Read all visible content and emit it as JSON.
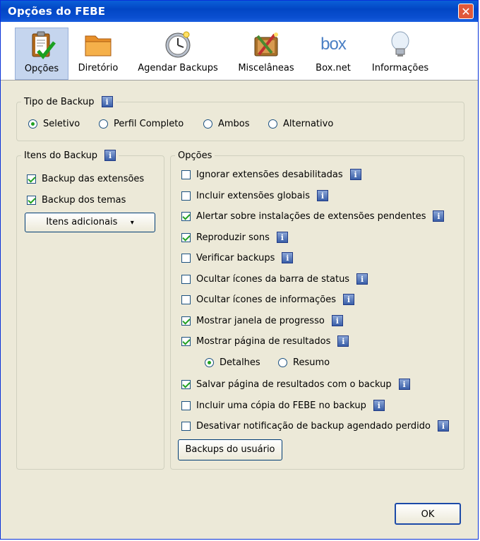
{
  "window": {
    "title": "Opções do FEBE",
    "close_glyph": "✕"
  },
  "toolbar": {
    "items": [
      {
        "label": "Opções",
        "icon": "clipboard-check-icon",
        "selected": true
      },
      {
        "label": "Diretório",
        "icon": "folder-icon"
      },
      {
        "label": "Agendar Backups",
        "icon": "clock-icon"
      },
      {
        "label": "Miscelâneas",
        "icon": "tools-icon"
      },
      {
        "label": "Box.net",
        "icon": "box-logo-icon",
        "logo_text": "box"
      },
      {
        "label": "Informações",
        "icon": "lightbulb-icon"
      }
    ]
  },
  "info_glyph": "i",
  "backup_type": {
    "legend": "Tipo de Backup",
    "options": [
      {
        "label": "Seletivo",
        "selected": true
      },
      {
        "label": "Perfil Completo",
        "selected": false
      },
      {
        "label": "Ambos",
        "selected": false
      },
      {
        "label": "Alternativo",
        "selected": false
      }
    ]
  },
  "backup_items": {
    "legend": "Itens do Backup",
    "checks": [
      {
        "label": "Backup das extensões",
        "checked": true
      },
      {
        "label": "Backup dos temas",
        "checked": true
      }
    ],
    "additional_button": "Itens adicionais",
    "dropdown_glyph": "▾"
  },
  "options": {
    "legend": "Opções",
    "items": [
      {
        "label": "Ignorar extensões desabilitadas",
        "checked": false
      },
      {
        "label": "Incluir extensões globais",
        "checked": false
      },
      {
        "label": "Alertar sobre instalações de extensões pendentes",
        "checked": true
      },
      {
        "label": "Reproduzir sons",
        "checked": true
      },
      {
        "label": "Verificar backups",
        "checked": false
      },
      {
        "label": "Ocultar ícones da barra de status",
        "checked": false
      },
      {
        "label": "Ocultar ícones de informações",
        "checked": false
      },
      {
        "label": "Mostrar janela de progresso",
        "checked": true
      },
      {
        "label": "Mostrar página de resultados",
        "checked": true
      }
    ],
    "results_mode": [
      {
        "label": "Detalhes",
        "selected": true
      },
      {
        "label": "Resumo",
        "selected": false
      }
    ],
    "items2": [
      {
        "label": "Salvar página de resultados com o backup",
        "checked": true
      },
      {
        "label": "Incluir uma cópia do FEBE no backup",
        "checked": false
      },
      {
        "label": "Desativar notificação de backup agendado perdido",
        "checked": false
      }
    ],
    "user_backups_button": "Backups do usuário"
  },
  "ok_button": "OK"
}
